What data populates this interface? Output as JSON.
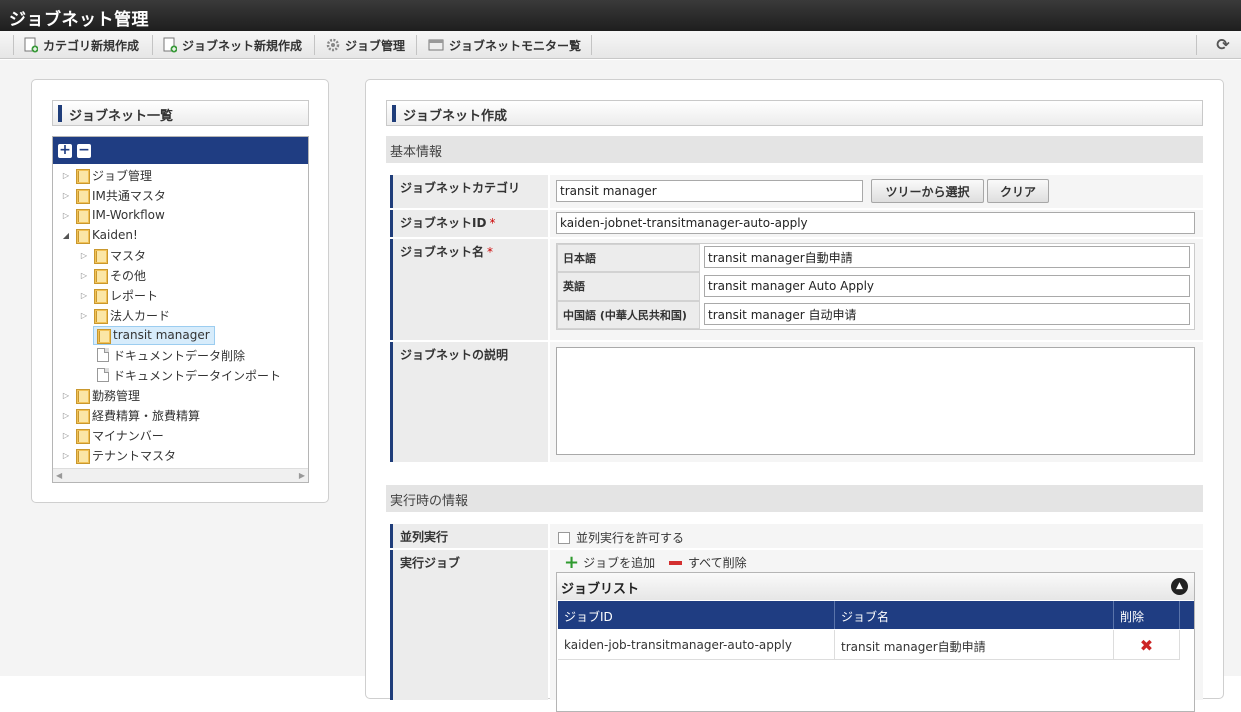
{
  "app": {
    "title": "ジョブネット管理"
  },
  "toolbar": {
    "new_category": "カテゴリ新規作成",
    "new_jobnet": "ジョブネット新規作成",
    "job_management": "ジョブ管理",
    "jobnet_monitor": "ジョブネットモニター覧",
    "refresh_icon": "refresh-icon"
  },
  "left": {
    "title": "ジョブネット一覧",
    "tree": [
      {
        "label": "ジョブ管理",
        "expanded": false
      },
      {
        "label": "IM共通マスタ",
        "expanded": false
      },
      {
        "label": "IM-Workflow",
        "expanded": false
      },
      {
        "label": "Kaiden!",
        "expanded": true
      },
      {
        "label": "マスタ",
        "expanded": false
      },
      {
        "label": "その他",
        "expanded": false
      },
      {
        "label": "レポート",
        "expanded": false
      },
      {
        "label": "法人カード",
        "expanded": false
      },
      {
        "label": "transit manager",
        "selected": true
      },
      {
        "label": "ドキュメントデータ削除"
      },
      {
        "label": "ドキュメントデータインポート"
      },
      {
        "label": "勤務管理",
        "expanded": false
      },
      {
        "label": "経費精算・旅費精算",
        "expanded": false
      },
      {
        "label": "マイナンバー",
        "expanded": false
      },
      {
        "label": "テナントマスタ",
        "expanded": false
      }
    ]
  },
  "form": {
    "title": "ジョブネット作成",
    "basic_info": "基本情報",
    "category_label": "ジョブネットカテゴリ",
    "category_value": "transit manager",
    "select_from_tree": "ツリーから選択",
    "clear": "クリア",
    "id_label": "ジョブネットID",
    "required_mark": "*",
    "id_value": "kaiden-jobnet-transitmanager-auto-apply",
    "name_label": "ジョブネット名",
    "names": [
      {
        "lang": "日本語",
        "value": "transit manager自動申請"
      },
      {
        "lang": "英語",
        "value": "transit manager Auto Apply"
      },
      {
        "lang": "中国語 (中華人民共和国)",
        "value": "transit manager 自动申请"
      }
    ],
    "description_label": "ジョブネットの説明",
    "description_value": "",
    "runtime_info": "実行時の情報",
    "parallel_label": "並列実行",
    "parallel_checkbox": "並列実行を許可する",
    "parallel_checked": false,
    "exec_job_label": "実行ジョブ",
    "add_job": "ジョブを追加",
    "delete_all": "すべて削除",
    "job_list": {
      "title": "ジョブリスト",
      "columns": [
        "ジョブID",
        "ジョブ名",
        "削除"
      ],
      "rows": [
        {
          "id": "kaiden-job-transitmanager-auto-apply",
          "name": "transit manager自動申請"
        }
      ]
    }
  },
  "colors": {
    "accent": "#1f3d82",
    "titlebar": "#2b2b2b",
    "delete": "#cc2222",
    "add": "#2f9a2f"
  }
}
